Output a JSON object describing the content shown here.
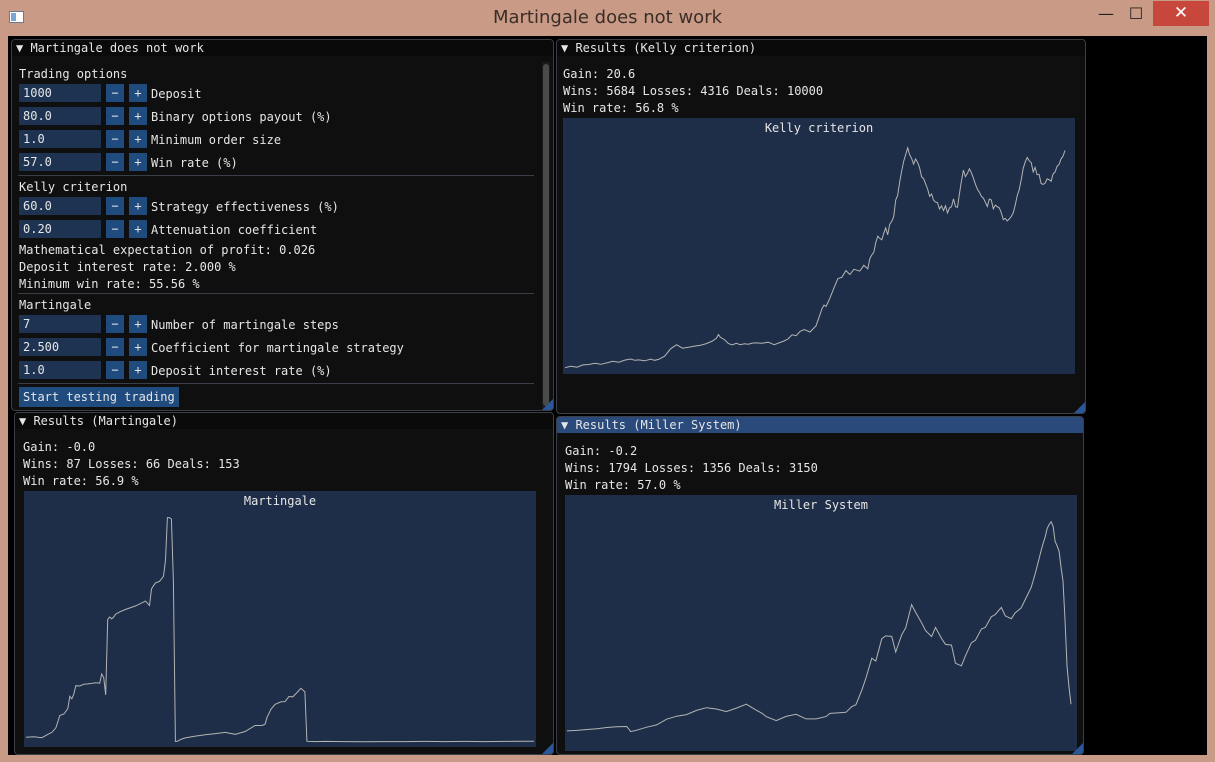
{
  "window": {
    "title": "Martingale does not work",
    "minimize": "—",
    "maximize": "☐",
    "close": "✕"
  },
  "settings": {
    "header": "▼ Martingale does not work",
    "sections": {
      "trading": "Trading options",
      "kelly": "Kelly criterion",
      "martingale": "Martingale"
    },
    "rows": [
      {
        "value": "1000",
        "label": "Deposit"
      },
      {
        "value": "80.0",
        "label": "Binary options payout (%)"
      },
      {
        "value": "1.0",
        "label": "Minimum order size"
      },
      {
        "value": "57.0",
        "label": "Win rate (%)"
      },
      {
        "value": "60.0",
        "label": "Strategy effectiveness (%)"
      },
      {
        "value": "0.20",
        "label": "Attenuation coefficient"
      },
      {
        "value": "7",
        "label": "Number of martingale steps"
      },
      {
        "value": "2.500",
        "label": "Coefficient for martingale strategy"
      },
      {
        "value": "1.0",
        "label": "Deposit interest rate (%)"
      }
    ],
    "info": [
      "Mathematical expectation of profit: 0.026",
      "Deposit interest rate: 2.000 %",
      "Minimum win rate: 55.56 %"
    ],
    "minus": "−",
    "plus": "+",
    "start_button": "Start testing trading"
  },
  "kelly": {
    "header": "▼ Results (Kelly criterion)",
    "gain": "Gain: 20.6",
    "stats": "Wins: 5684 Losses: 4316 Deals: 10000",
    "winrate": "Win rate: 56.8 %",
    "plot_title": "Kelly criterion"
  },
  "martingale": {
    "header": "▼ Results (Martingale)",
    "gain": "Gain: -0.0",
    "stats": "Wins: 87 Losses: 66 Deals: 153",
    "winrate": "Win rate: 56.9 %",
    "plot_title": "Martingale"
  },
  "miller": {
    "header": "▼ Results (Miller System)",
    "gain": "Gain: -0.2",
    "stats": "Wins: 1794 Losses: 1356 Deals: 3150",
    "winrate": "Win rate: 57.0 %",
    "plot_title": "Miller System"
  },
  "colors": {
    "plot_bg": "#1e2e48",
    "line": "#b4b4b4",
    "field": "#1d3351",
    "button": "#1f4b7e",
    "active_header": "#294a7a"
  },
  "chart_data": [
    {
      "type": "line",
      "title": "Kelly criterion",
      "x": [
        0,
        6,
        12,
        18,
        24,
        30,
        36,
        42,
        48,
        54,
        60,
        66,
        70,
        74,
        80,
        86,
        90,
        94,
        100,
        106,
        112,
        118,
        124,
        130,
        136,
        142,
        148,
        152,
        154,
        156,
        160,
        164,
        168,
        172,
        176,
        180,
        184,
        188,
        192,
        198,
        204,
        210,
        216,
        220,
        224,
        228,
        232,
        236,
        240,
        246,
        252,
        256,
        258,
        260,
        262,
        264,
        266,
        270,
        274,
        278,
        282,
        286,
        290,
        296,
        300,
        304,
        306,
        308,
        310,
        312,
        314,
        316,
        318,
        320,
        322,
        324,
        326,
        328,
        330,
        332,
        334,
        336,
        338,
        340,
        342,
        344,
        346,
        348,
        350,
        352,
        354,
        356,
        358,
        360,
        362,
        364,
        366,
        368,
        370,
        372,
        374,
        376,
        378,
        380,
        382,
        384,
        386,
        388,
        390,
        392,
        394,
        396,
        398,
        400,
        402,
        404,
        406,
        408,
        410,
        412,
        414,
        416,
        418,
        420,
        422,
        424,
        426,
        428,
        430,
        432,
        434,
        436,
        438,
        440,
        442,
        444,
        446,
        448,
        450,
        452,
        454,
        456,
        458,
        460,
        462,
        464,
        466,
        468,
        470,
        472,
        474,
        476,
        478,
        480,
        482,
        484,
        486,
        488,
        490,
        492,
        494,
        496,
        498,
        500,
        502,
        504,
        506,
        508,
        510
      ],
      "y": [
        1.0,
        1.6,
        1.2,
        2.2,
        2.4,
        2.9,
        2.5,
        3.1,
        3.8,
        3.4,
        4.3,
        4.8,
        4.2,
        4.4,
        4.0,
        4.7,
        4.2,
        4.6,
        6.0,
        9.2,
        11.0,
        9.5,
        9.9,
        10.4,
        10.8,
        11.5,
        12.6,
        13.8,
        15.4,
        14.2,
        13.2,
        11.5,
        10.9,
        11.6,
        11.0,
        11.4,
        11.2,
        11.7,
        11.8,
        11.6,
        12.1,
        11.0,
        12.0,
        12.6,
        13.5,
        15.3,
        14.9,
        16.8,
        17.6,
        16.5,
        19.2,
        24.1,
        26.7,
        28.2,
        27.6,
        29.4,
        31.4,
        35.6,
        39.8,
        40.3,
        43.2,
        41.5,
        43.8,
        43.0,
        45.5,
        44.0,
        48.4,
        50.0,
        51.2,
        55.4,
        58.2,
        57.2,
        56.6,
        59.4,
        61.8,
        58.8,
        63.3,
        64.6,
        66.7,
        73.9,
        76.0,
        81.8,
        86.6,
        90.8,
        93.7,
        96.6,
        93.6,
        92.0,
        89.5,
        91.8,
        90.2,
        87.9,
        84.0,
        83.2,
        80.9,
        78.7,
        75.5,
        76.5,
        73.9,
        73.0,
        72.8,
        70.0,
        71.4,
        69.3,
        71.4,
        68.3,
        70.5,
        71.0,
        74.4,
        71.0,
        70.8,
        76.5,
        82.1,
        86.9,
        84.1,
        85.5,
        87.5,
        85.8,
        83.4,
        80.8,
        78.6,
        77.3,
        75.5,
        74.7,
        73.0,
        71.1,
        74.3,
        73.9,
        70.1,
        71.7,
        71.0,
        70.5,
        68.4,
        65.4,
        65.9,
        64.8,
        65.7,
        66.7,
        68.3,
        71.6,
        75.8,
        78.4,
        82.7,
        87.7,
        90.4,
        92.4,
        91.0,
        90.2,
        86.1,
        88.1,
        84.9,
        85.1,
        81.1,
        80.7,
        81.2,
        83.1,
        82.8,
        82.1,
        85.2,
        86.1,
        88.6,
        89.4,
        91.8,
        92.9,
        95.5
      ],
      "ylim": [
        0,
        100
      ]
    },
    {
      "type": "line",
      "title": "Martingale",
      "x": [
        0,
        8,
        16,
        22,
        26,
        30,
        34,
        38,
        42,
        44,
        46,
        48,
        50,
        54,
        58,
        62,
        66,
        70,
        74,
        76,
        78,
        80,
        82,
        84,
        86,
        88,
        90,
        94,
        100,
        110,
        120,
        124,
        126,
        128,
        130,
        134,
        138,
        140,
        142,
        144,
        146,
        148,
        150,
        152,
        156,
        160,
        170,
        180,
        190,
        200,
        210,
        220,
        230,
        236,
        238,
        240,
        242,
        244,
        246,
        250,
        256,
        260,
        264,
        268,
        272,
        276,
        280,
        282,
        284,
        290,
        300,
        320,
        340,
        360,
        380,
        400,
        420,
        440,
        460,
        480,
        500,
        510
      ],
      "y": [
        2.5,
        2.7,
        2.3,
        3.8,
        4.6,
        6.6,
        12.0,
        12.6,
        14.9,
        20.3,
        19.2,
        21.2,
        24.9,
        24.8,
        25.5,
        25.7,
        25.9,
        26.2,
        26.0,
        30.0,
        28.5,
        20.9,
        53.7,
        54.8,
        54.0,
        54.8,
        56.0,
        57.0,
        58.1,
        59.6,
        61.7,
        59.8,
        67.0,
        68.4,
        69.6,
        70.3,
        72.5,
        79.5,
        98.0,
        98.0,
        97.4,
        70.3,
        0.7,
        0.8,
        1.7,
        2.2,
        3.0,
        3.6,
        4.1,
        4.6,
        3.8,
        5.0,
        7.6,
        7.6,
        7.8,
        8.2,
        11.2,
        12.9,
        14.7,
        16.8,
        17.9,
        18.0,
        20.2,
        20.1,
        21.9,
        23.8,
        22.2,
        0.8,
        0.7,
        0.6,
        0.7,
        0.6,
        0.5,
        0.6,
        0.6,
        0.7,
        0.6,
        0.7,
        0.6,
        0.7,
        0.8,
        0.8
      ],
      "ylim": [
        0,
        100
      ]
    },
    {
      "type": "line",
      "title": "Miller System",
      "x": [
        0,
        10,
        20,
        30,
        40,
        50,
        60,
        64,
        70,
        80,
        90,
        100,
        110,
        120,
        130,
        140,
        150,
        160,
        170,
        180,
        190,
        196,
        200,
        210,
        220,
        230,
        240,
        250,
        260,
        264,
        270,
        280,
        286,
        290,
        296,
        300,
        306,
        310,
        316,
        320,
        326,
        330,
        336,
        340,
        346,
        350,
        356,
        360,
        366,
        370,
        376,
        380,
        386,
        390,
        396,
        400,
        406,
        410,
        416,
        420,
        426,
        430,
        436,
        440,
        446,
        450,
        456,
        460,
        466,
        470,
        474,
        476,
        478,
        480,
        482,
        484,
        486,
        488,
        490,
        492,
        494,
        496,
        498,
        500,
        502,
        504,
        506
      ],
      "y": [
        7.0,
        7.2,
        7.6,
        7.9,
        8.5,
        8.8,
        8.9,
        6.7,
        7.3,
        8.6,
        9.6,
        12.1,
        13.4,
        14.1,
        15.9,
        17.1,
        16.5,
        15.4,
        16.9,
        18.6,
        16.0,
        14.6,
        13.2,
        11.5,
        13.3,
        14.2,
        12.2,
        12.2,
        13.2,
        14.6,
        14.8,
        15.1,
        17.6,
        18.4,
        24.7,
        29.8,
        38.6,
        37.4,
        47.1,
        48.3,
        48.1,
        41.3,
        48.8,
        51.8,
        61.9,
        58.6,
        54.0,
        50.6,
        48.0,
        52.0,
        47.2,
        44.6,
        44.3,
        36.4,
        35.3,
        39.6,
        45.3,
        46.4,
        51.3,
        52.0,
        56.6,
        57.6,
        60.7,
        57.0,
        55.8,
        58.3,
        60.5,
        64.1,
        69.4,
        75.4,
        81.9,
        85.4,
        88.5,
        91.2,
        94.9,
        96.7,
        97.9,
        96.0,
        89.4,
        87.5,
        85.1,
        77.9,
        72.2,
        55.3,
        35.3,
        26.0,
        18.6
      ],
      "ylim": [
        0,
        100
      ]
    }
  ]
}
